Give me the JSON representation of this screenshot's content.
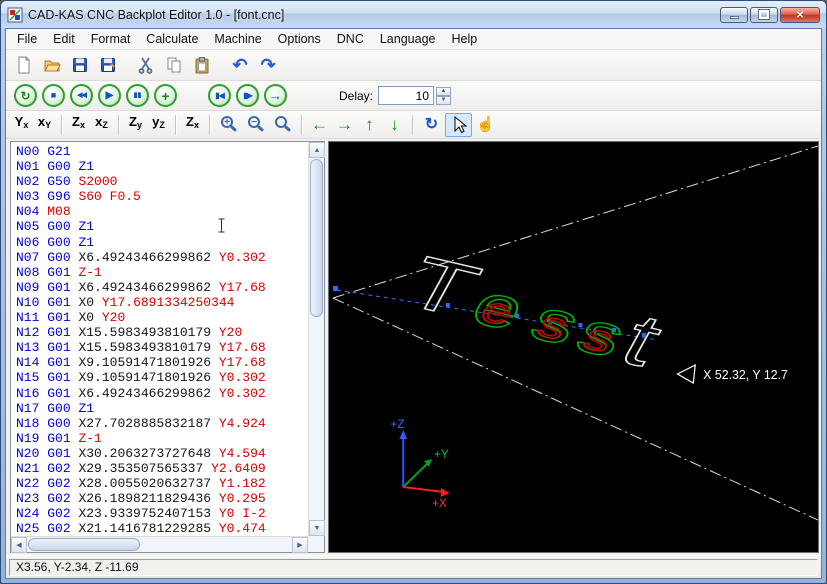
{
  "window": {
    "title": "CAD-KAS CNC Backplot Editor 1.0 - [font.cnc]",
    "controls": [
      "minimize",
      "maximize",
      "close"
    ],
    "close_glyph": "×"
  },
  "menu": [
    "File",
    "Edit",
    "Format",
    "Calculate",
    "Machine",
    "Options",
    "DNC",
    "Language",
    "Help"
  ],
  "file_toolbar": [
    "new-file",
    "open-file",
    "save-file",
    "save-file-as",
    "cut",
    "copy",
    "paste",
    "undo",
    "redo"
  ],
  "icons": {
    "undo_glyph": "↶",
    "redo_glyph": "↷",
    "rotate_glyph": "↻",
    "hand_glyph": "☝",
    "spinner_up": "▲",
    "spinner_down": "▼",
    "scroll_up": "▲",
    "scroll_down": "▼",
    "scroll_left": "◀",
    "scroll_right": "▶"
  },
  "playback": {
    "buttons": [
      {
        "name": "restart",
        "glyph": "↻"
      },
      {
        "name": "stop",
        "glyph": "■"
      },
      {
        "name": "rewind",
        "glyph": "◀◀"
      },
      {
        "name": "play",
        "glyph": "▶"
      },
      {
        "name": "pause",
        "glyph": "▮▮"
      },
      {
        "name": "insert",
        "glyph": "+"
      },
      {
        "name": "skip-to-start",
        "glyph": "▮◀"
      },
      {
        "name": "step-forward",
        "glyph": "▮▶"
      },
      {
        "name": "skip-to-end",
        "glyph": "→"
      }
    ],
    "delay_label": "Delay:",
    "delay_value": "10"
  },
  "view_toolbar": {
    "views": [
      {
        "big": "Y",
        "small": "x"
      },
      {
        "big": "x",
        "small": "Y"
      },
      {
        "big": "Z",
        "small": "x"
      },
      {
        "big": "x",
        "small": "Z"
      },
      {
        "big": "Z",
        "small": "y"
      },
      {
        "big": "y",
        "small": "Z"
      },
      {
        "big": "Z",
        "small": "x"
      }
    ],
    "zoom": [
      {
        "name": "zoom-in",
        "sign": "+"
      },
      {
        "name": "zoom-out",
        "sign": "−"
      },
      {
        "name": "zoom-reset",
        "sign": ""
      }
    ],
    "pan_arrows": [
      {
        "name": "pan-left",
        "glyph": "←"
      },
      {
        "name": "pan-right",
        "glyph": "→"
      },
      {
        "name": "pan-up",
        "glyph": "↑"
      },
      {
        "name": "pan-down",
        "glyph": "↓"
      }
    ]
  },
  "editor": {
    "lines": [
      [
        [
          "N00",
          "b"
        ],
        [
          "G21",
          "b"
        ]
      ],
      [
        [
          "N01",
          "b"
        ],
        [
          "G00",
          "b"
        ],
        [
          "Z1",
          "b"
        ]
      ],
      [
        [
          "N02",
          "b"
        ],
        [
          "G50",
          "b"
        ],
        [
          "S2000",
          "r"
        ]
      ],
      [
        [
          "N03",
          "b"
        ],
        [
          "G96",
          "b"
        ],
        [
          "S60",
          "r"
        ],
        [
          "F0.5",
          "r"
        ]
      ],
      [
        [
          "N04",
          "b"
        ],
        [
          "M08",
          "r"
        ]
      ],
      [
        [
          "N05",
          "b"
        ],
        [
          "G00",
          "b"
        ],
        [
          "Z1",
          "b"
        ]
      ],
      [
        [
          "N06",
          "b"
        ],
        [
          "G00",
          "b"
        ],
        [
          "Z1",
          "b"
        ]
      ],
      [
        [
          "N07",
          "b"
        ],
        [
          "G00",
          "b"
        ],
        [
          "X6.49243466299862",
          "k"
        ],
        [
          "Y0.302",
          "r"
        ]
      ],
      [
        [
          "N08",
          "b"
        ],
        [
          "G01",
          "b"
        ],
        [
          "Z-1",
          "r"
        ]
      ],
      [
        [
          "N09",
          "b"
        ],
        [
          "G01",
          "b"
        ],
        [
          "X6.49243466299862",
          "k"
        ],
        [
          "Y17.68",
          "r"
        ]
      ],
      [
        [
          "N10",
          "b"
        ],
        [
          "G01",
          "b"
        ],
        [
          "X0",
          "k"
        ],
        [
          "Y17.6891334250344",
          "r"
        ]
      ],
      [
        [
          "N11",
          "b"
        ],
        [
          "G01",
          "b"
        ],
        [
          "X0",
          "k"
        ],
        [
          "Y20",
          "r"
        ]
      ],
      [
        [
          "N12",
          "b"
        ],
        [
          "G01",
          "b"
        ],
        [
          "X15.5983493810179",
          "k"
        ],
        [
          "Y20",
          "r"
        ]
      ],
      [
        [
          "N13",
          "b"
        ],
        [
          "G01",
          "b"
        ],
        [
          "X15.5983493810179",
          "k"
        ],
        [
          "Y17.68",
          "r"
        ]
      ],
      [
        [
          "N14",
          "b"
        ],
        [
          "G01",
          "b"
        ],
        [
          "X9.10591471801926",
          "k"
        ],
        [
          "Y17.68",
          "r"
        ]
      ],
      [
        [
          "N15",
          "b"
        ],
        [
          "G01",
          "b"
        ],
        [
          "X9.10591471801926",
          "k"
        ],
        [
          "Y0.302",
          "r"
        ]
      ],
      [
        [
          "N16",
          "b"
        ],
        [
          "G01",
          "b"
        ],
        [
          "X6.49243466299862",
          "k"
        ],
        [
          "Y0.302",
          "r"
        ]
      ],
      [
        [
          "N17",
          "b"
        ],
        [
          "G00",
          "b"
        ],
        [
          "Z1",
          "b"
        ]
      ],
      [
        [
          "N18",
          "b"
        ],
        [
          "G00",
          "b"
        ],
        [
          "X27.7028885832187",
          "k"
        ],
        [
          "Y4.924",
          "r"
        ]
      ],
      [
        [
          "N19",
          "b"
        ],
        [
          "G01",
          "b"
        ],
        [
          "Z-1",
          "r"
        ]
      ],
      [
        [
          "N20",
          "b"
        ],
        [
          "G01",
          "b"
        ],
        [
          "X30.2063273727648",
          "k"
        ],
        [
          "Y4.594",
          "r"
        ]
      ],
      [
        [
          "N21",
          "b"
        ],
        [
          "G02",
          "b"
        ],
        [
          "X29.353507565337",
          "k"
        ],
        [
          "Y2.6409",
          "r"
        ]
      ],
      [
        [
          "N22",
          "b"
        ],
        [
          "G02",
          "b"
        ],
        [
          "X28.0055020632737",
          "k"
        ],
        [
          "Y1.182",
          "r"
        ]
      ],
      [
        [
          "N23",
          "b"
        ],
        [
          "G02",
          "b"
        ],
        [
          "X26.1898211829436",
          "k"
        ],
        [
          "Y0.295",
          "r"
        ]
      ],
      [
        [
          "N24",
          "b"
        ],
        [
          "G02",
          "b"
        ],
        [
          "X23.9339752407153",
          "k"
        ],
        [
          "Y0",
          "r"
        ],
        [
          "I-2",
          "r"
        ]
      ],
      [
        [
          "N25",
          "b"
        ],
        [
          "G02",
          "b"
        ],
        [
          "X21.1416781229285",
          "k"
        ],
        [
          "Y0.474",
          "r"
        ]
      ]
    ]
  },
  "canvas": {
    "letters": [
      "T",
      "e",
      "s",
      "s",
      "t"
    ],
    "position_label": "X 52.32, Y 12.7",
    "axis_labels": {
      "x": "+X",
      "y": "+Y",
      "z": "+Z"
    },
    "colors": {
      "path_white": "#e8e8e8",
      "path_green": "#00b400",
      "path_red": "#d00000",
      "marker_blue": "#2d6bff"
    }
  },
  "status": "X3.56, Y-2.34, Z -11.69"
}
